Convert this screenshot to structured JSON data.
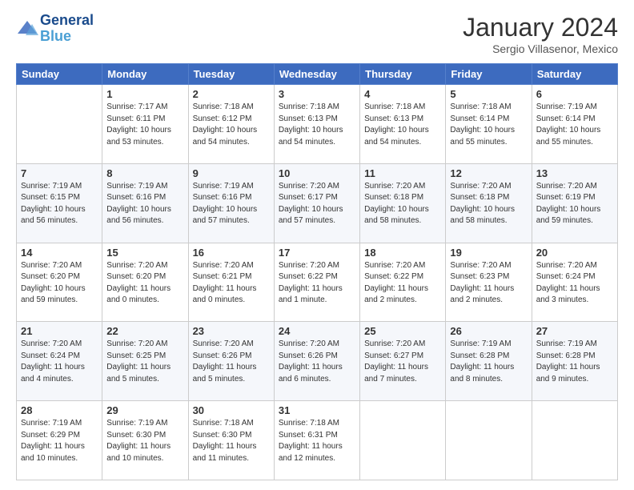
{
  "header": {
    "logo_line1": "General",
    "logo_line2": "Blue",
    "month": "January 2024",
    "subtitle": "Sergio Villasenor, Mexico"
  },
  "columns": [
    "Sunday",
    "Monday",
    "Tuesday",
    "Wednesday",
    "Thursday",
    "Friday",
    "Saturday"
  ],
  "weeks": [
    [
      {
        "day": "",
        "info": ""
      },
      {
        "day": "1",
        "info": "Sunrise: 7:17 AM\nSunset: 6:11 PM\nDaylight: 10 hours\nand 53 minutes."
      },
      {
        "day": "2",
        "info": "Sunrise: 7:18 AM\nSunset: 6:12 PM\nDaylight: 10 hours\nand 54 minutes."
      },
      {
        "day": "3",
        "info": "Sunrise: 7:18 AM\nSunset: 6:13 PM\nDaylight: 10 hours\nand 54 minutes."
      },
      {
        "day": "4",
        "info": "Sunrise: 7:18 AM\nSunset: 6:13 PM\nDaylight: 10 hours\nand 54 minutes."
      },
      {
        "day": "5",
        "info": "Sunrise: 7:18 AM\nSunset: 6:14 PM\nDaylight: 10 hours\nand 55 minutes."
      },
      {
        "day": "6",
        "info": "Sunrise: 7:19 AM\nSunset: 6:14 PM\nDaylight: 10 hours\nand 55 minutes."
      }
    ],
    [
      {
        "day": "7",
        "info": "Sunrise: 7:19 AM\nSunset: 6:15 PM\nDaylight: 10 hours\nand 56 minutes."
      },
      {
        "day": "8",
        "info": "Sunrise: 7:19 AM\nSunset: 6:16 PM\nDaylight: 10 hours\nand 56 minutes."
      },
      {
        "day": "9",
        "info": "Sunrise: 7:19 AM\nSunset: 6:16 PM\nDaylight: 10 hours\nand 57 minutes."
      },
      {
        "day": "10",
        "info": "Sunrise: 7:20 AM\nSunset: 6:17 PM\nDaylight: 10 hours\nand 57 minutes."
      },
      {
        "day": "11",
        "info": "Sunrise: 7:20 AM\nSunset: 6:18 PM\nDaylight: 10 hours\nand 58 minutes."
      },
      {
        "day": "12",
        "info": "Sunrise: 7:20 AM\nSunset: 6:18 PM\nDaylight: 10 hours\nand 58 minutes."
      },
      {
        "day": "13",
        "info": "Sunrise: 7:20 AM\nSunset: 6:19 PM\nDaylight: 10 hours\nand 59 minutes."
      }
    ],
    [
      {
        "day": "14",
        "info": "Sunrise: 7:20 AM\nSunset: 6:20 PM\nDaylight: 10 hours\nand 59 minutes."
      },
      {
        "day": "15",
        "info": "Sunrise: 7:20 AM\nSunset: 6:20 PM\nDaylight: 11 hours\nand 0 minutes."
      },
      {
        "day": "16",
        "info": "Sunrise: 7:20 AM\nSunset: 6:21 PM\nDaylight: 11 hours\nand 0 minutes."
      },
      {
        "day": "17",
        "info": "Sunrise: 7:20 AM\nSunset: 6:22 PM\nDaylight: 11 hours\nand 1 minute."
      },
      {
        "day": "18",
        "info": "Sunrise: 7:20 AM\nSunset: 6:22 PM\nDaylight: 11 hours\nand 2 minutes."
      },
      {
        "day": "19",
        "info": "Sunrise: 7:20 AM\nSunset: 6:23 PM\nDaylight: 11 hours\nand 2 minutes."
      },
      {
        "day": "20",
        "info": "Sunrise: 7:20 AM\nSunset: 6:24 PM\nDaylight: 11 hours\nand 3 minutes."
      }
    ],
    [
      {
        "day": "21",
        "info": "Sunrise: 7:20 AM\nSunset: 6:24 PM\nDaylight: 11 hours\nand 4 minutes."
      },
      {
        "day": "22",
        "info": "Sunrise: 7:20 AM\nSunset: 6:25 PM\nDaylight: 11 hours\nand 5 minutes."
      },
      {
        "day": "23",
        "info": "Sunrise: 7:20 AM\nSunset: 6:26 PM\nDaylight: 11 hours\nand 5 minutes."
      },
      {
        "day": "24",
        "info": "Sunrise: 7:20 AM\nSunset: 6:26 PM\nDaylight: 11 hours\nand 6 minutes."
      },
      {
        "day": "25",
        "info": "Sunrise: 7:20 AM\nSunset: 6:27 PM\nDaylight: 11 hours\nand 7 minutes."
      },
      {
        "day": "26",
        "info": "Sunrise: 7:19 AM\nSunset: 6:28 PM\nDaylight: 11 hours\nand 8 minutes."
      },
      {
        "day": "27",
        "info": "Sunrise: 7:19 AM\nSunset: 6:28 PM\nDaylight: 11 hours\nand 9 minutes."
      }
    ],
    [
      {
        "day": "28",
        "info": "Sunrise: 7:19 AM\nSunset: 6:29 PM\nDaylight: 11 hours\nand 10 minutes."
      },
      {
        "day": "29",
        "info": "Sunrise: 7:19 AM\nSunset: 6:30 PM\nDaylight: 11 hours\nand 10 minutes."
      },
      {
        "day": "30",
        "info": "Sunrise: 7:18 AM\nSunset: 6:30 PM\nDaylight: 11 hours\nand 11 minutes."
      },
      {
        "day": "31",
        "info": "Sunrise: 7:18 AM\nSunset: 6:31 PM\nDaylight: 11 hours\nand 12 minutes."
      },
      {
        "day": "",
        "info": ""
      },
      {
        "day": "",
        "info": ""
      },
      {
        "day": "",
        "info": ""
      }
    ]
  ]
}
